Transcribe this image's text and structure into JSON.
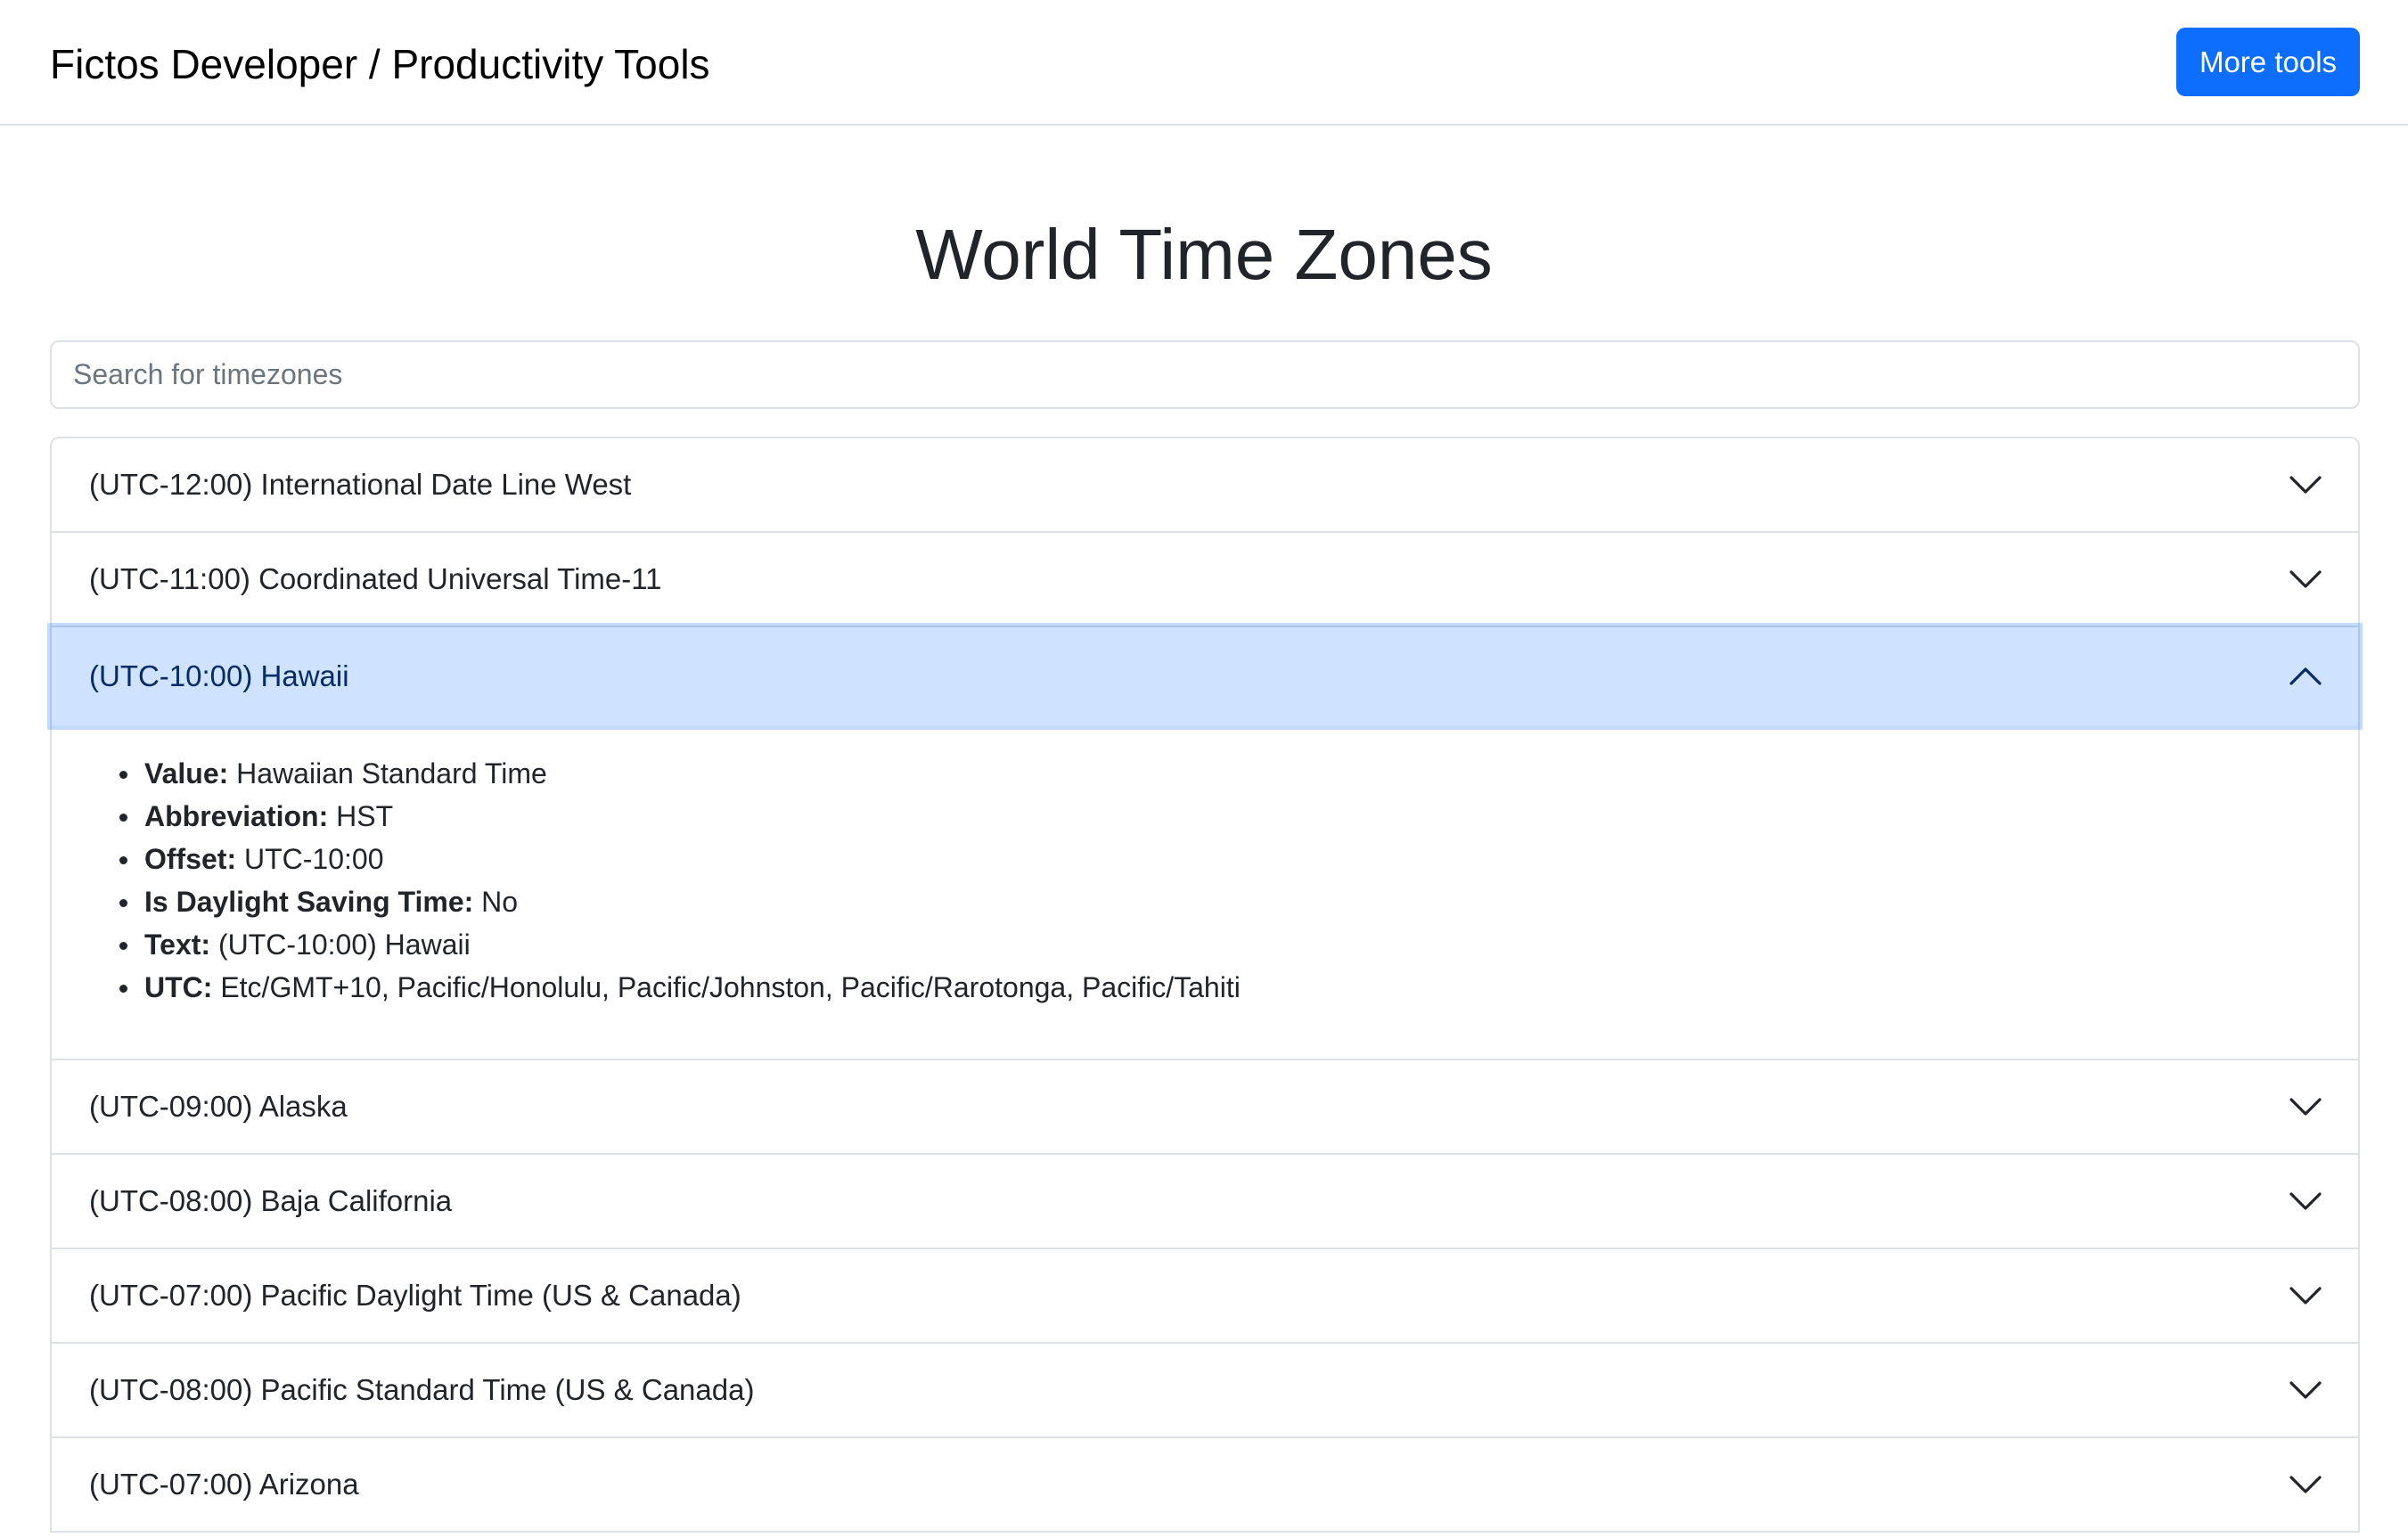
{
  "header": {
    "brand": "Fictos Developer / Productivity Tools",
    "more_tools_label": "More tools"
  },
  "page": {
    "title": "World Time Zones"
  },
  "search": {
    "placeholder": "Search for timezones",
    "value": ""
  },
  "colors": {
    "primary": "#0d6efd",
    "active_header_bg": "#cfe2ff",
    "border": "#dee2e6"
  },
  "timezones": [
    {
      "label": "(UTC-12:00) International Date Line West",
      "expanded": false,
      "chevron_icon": "chevron-down-icon"
    },
    {
      "label": "(UTC-11:00) Coordinated Universal Time-11",
      "expanded": false,
      "chevron_icon": "chevron-down-icon"
    },
    {
      "label": "(UTC-10:00) Hawaii",
      "expanded": true,
      "chevron_icon": "chevron-up-icon",
      "details": [
        {
          "key": "Value:",
          "value": "Hawaiian Standard Time"
        },
        {
          "key": "Abbreviation:",
          "value": "HST"
        },
        {
          "key": "Offset:",
          "value": "UTC-10:00"
        },
        {
          "key": "Is Daylight Saving Time:",
          "value": "No"
        },
        {
          "key": "Text:",
          "value": "(UTC-10:00) Hawaii"
        },
        {
          "key": "UTC:",
          "value": "Etc/GMT+10, Pacific/Honolulu, Pacific/Johnston, Pacific/Rarotonga, Pacific/Tahiti"
        }
      ]
    },
    {
      "label": "(UTC-09:00) Alaska",
      "expanded": false,
      "chevron_icon": "chevron-down-icon"
    },
    {
      "label": "(UTC-08:00) Baja California",
      "expanded": false,
      "chevron_icon": "chevron-down-icon"
    },
    {
      "label": "(UTC-07:00) Pacific Daylight Time (US & Canada)",
      "expanded": false,
      "chevron_icon": "chevron-down-icon"
    },
    {
      "label": "(UTC-08:00) Pacific Standard Time (US & Canada)",
      "expanded": false,
      "chevron_icon": "chevron-down-icon"
    },
    {
      "label": "(UTC-07:00) Arizona",
      "expanded": false,
      "chevron_icon": "chevron-down-icon"
    }
  ]
}
